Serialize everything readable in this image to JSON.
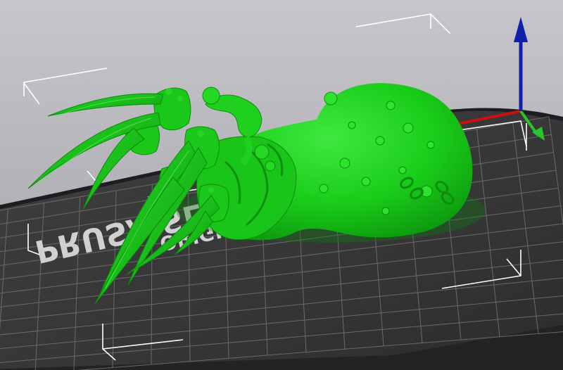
{
  "app": {
    "view": "3D plater",
    "bed_logo_text": "ORIGINAL PRUSA SL",
    "bed_logo_line1": "ORIGINAL",
    "bed_logo_line2": "PRUSA SL"
  },
  "colors": {
    "background_top": "#c3c3c8",
    "background_bottom": "#a2a2a8",
    "bed_surface": "#3a3a3b",
    "bed_grid": "#6a6a6c",
    "bed_edge": "#1c1c1e",
    "model": "#17d117",
    "model_shadow": "#0b7f0b",
    "axis_x": "#cc1010",
    "axis_y": "#2bc22b",
    "axis_z": "#1020a8",
    "selection_corners": "#ffffff"
  },
  "model": {
    "name": "tentacle creature with claws",
    "state": "selected"
  },
  "icons": [
    "axis-z-arrow-icon",
    "axis-x-line-icon",
    "axis-y-arrow-icon"
  ]
}
